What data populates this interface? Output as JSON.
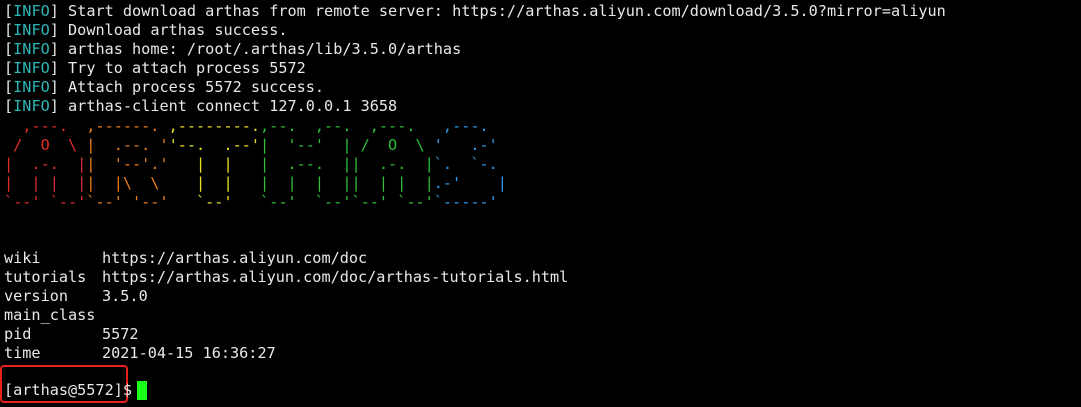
{
  "log": {
    "tag": "INFO",
    "lines": [
      "Start download arthas from remote server: https://arthas.aliyun.com/download/3.5.0?mirror=aliyun",
      "Download arthas success.",
      "arthas home: /root/.arthas/lib/3.5.0/arthas",
      "Try to attach process 5572",
      "Attach process 5572 success.",
      "arthas-client connect 127.0.0.1 3658"
    ]
  },
  "banner": {
    "letters": [
      "A",
      "R",
      "T",
      "H",
      "A",
      "S"
    ],
    "colors": {
      "A1": "#e22d2d",
      "R": "#f07f1a",
      "T": "#e8e020",
      "H": "#2ec03a",
      "A2": "#2ec03a",
      "S": "#2f9be8"
    }
  },
  "info": [
    {
      "key": "wiki",
      "value": "https://arthas.aliyun.com/doc"
    },
    {
      "key": "tutorials",
      "value": "https://arthas.aliyun.com/doc/arthas-tutorials.html"
    },
    {
      "key": "version",
      "value": "3.5.0"
    },
    {
      "key": "main_class",
      "value": ""
    },
    {
      "key": "pid",
      "value": "5572"
    },
    {
      "key": "time",
      "value": "2021-04-15 16:36:27"
    }
  ],
  "prompt": {
    "text": "[arthas@5572]$"
  },
  "colors": {
    "background": "#000000",
    "text": "#e8e8e8",
    "info_tag": "#2db7b7",
    "highlight_box": "#e8221a",
    "cursor": "#1aff1a"
  }
}
